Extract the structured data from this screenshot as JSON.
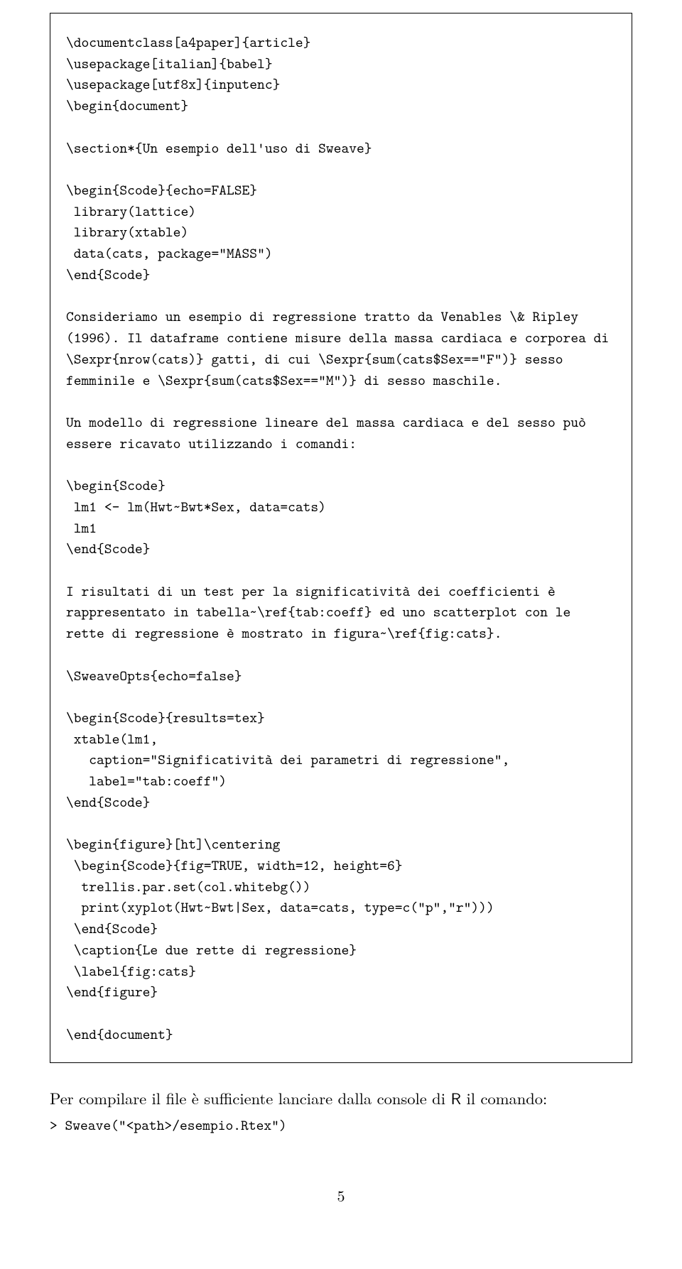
{
  "codebox": {
    "text": "\\documentclass[a4paper]{article}\n\\usepackage[italian]{babel}\n\\usepackage[utf8x]{inputenc}\n\\begin{document}\n\n\\section*{Un esempio dell'uso di Sweave}\n\n\\begin{Scode}{echo=FALSE}\n library(lattice)\n library(xtable)\n data(cats, package=\"MASS\")\n\\end{Scode}\n\nConsideriamo un esempio di regressione tratto da Venables \\& Ripley (1996). Il dataframe contiene misure della massa cardiaca e corporea di \\Sexpr{nrow(cats)} gatti, di cui \\Sexpr{sum(cats$Sex==\"F\")} sesso femminile e \\Sexpr{sum(cats$Sex==\"M\")} di sesso maschile.\n\nUn modello di regressione lineare del massa cardiaca e del sesso può essere ricavato utilizzando i comandi:\n\n\\begin{Scode}\n lm1 <- lm(Hwt~Bwt*Sex, data=cats)\n lm1\n\\end{Scode}\n\nI risultati di un test per la significatività dei coefficienti è rappresentato in tabella~\\ref{tab:coeff} ed uno scatterplot con le rette di regressione è mostrato in figura~\\ref{fig:cats}.\n\n\\SweaveOpts{echo=false}\n\n\\begin{Scode}{results=tex}\n xtable(lm1,\n   caption=\"Significatività dei parametri di regressione\",\n   label=\"tab:coeff\")\n\\end{Scode}\n\n\\begin{figure}[ht]\\centering\n \\begin{Scode}{fig=TRUE, width=12, height=6}\n  trellis.par.set(col.whitebg())\n  print(xyplot(Hwt~Bwt|Sex, data=cats, type=c(\"p\",\"r\")))\n \\end{Scode}\n \\caption{Le due rette di regressione}\n \\label{fig:cats}\n\\end{figure}\n\n\\end{document}"
  },
  "body": {
    "prefix": "Per compilare il file è sufficiente lanciare dalla console di ",
    "sans": "R",
    "suffix": " il comando:"
  },
  "cmd": "> Sweave(\"<path>/esempio.Rtex\")",
  "pagenum": "5"
}
